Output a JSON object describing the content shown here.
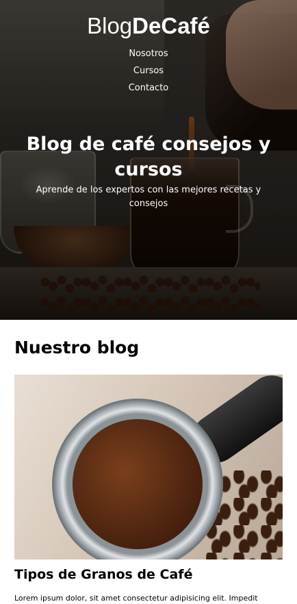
{
  "header": {
    "logo_light": "Blog",
    "logo_bold": "DeCafé",
    "nav": [
      "Nosotros",
      "Cursos",
      "Contacto"
    ]
  },
  "hero": {
    "title": "Blog de café consejos y cursos",
    "subtitle": "Aprende de los expertos con las mejores recetas y consejos"
  },
  "blog": {
    "section_title": "Nuestro blog",
    "posts": [
      {
        "title": "Tipos de Granos de Café",
        "excerpt": "Lorem ipsum dolor, sit amet consectetur adipisicing elit. Impedit"
      }
    ]
  }
}
